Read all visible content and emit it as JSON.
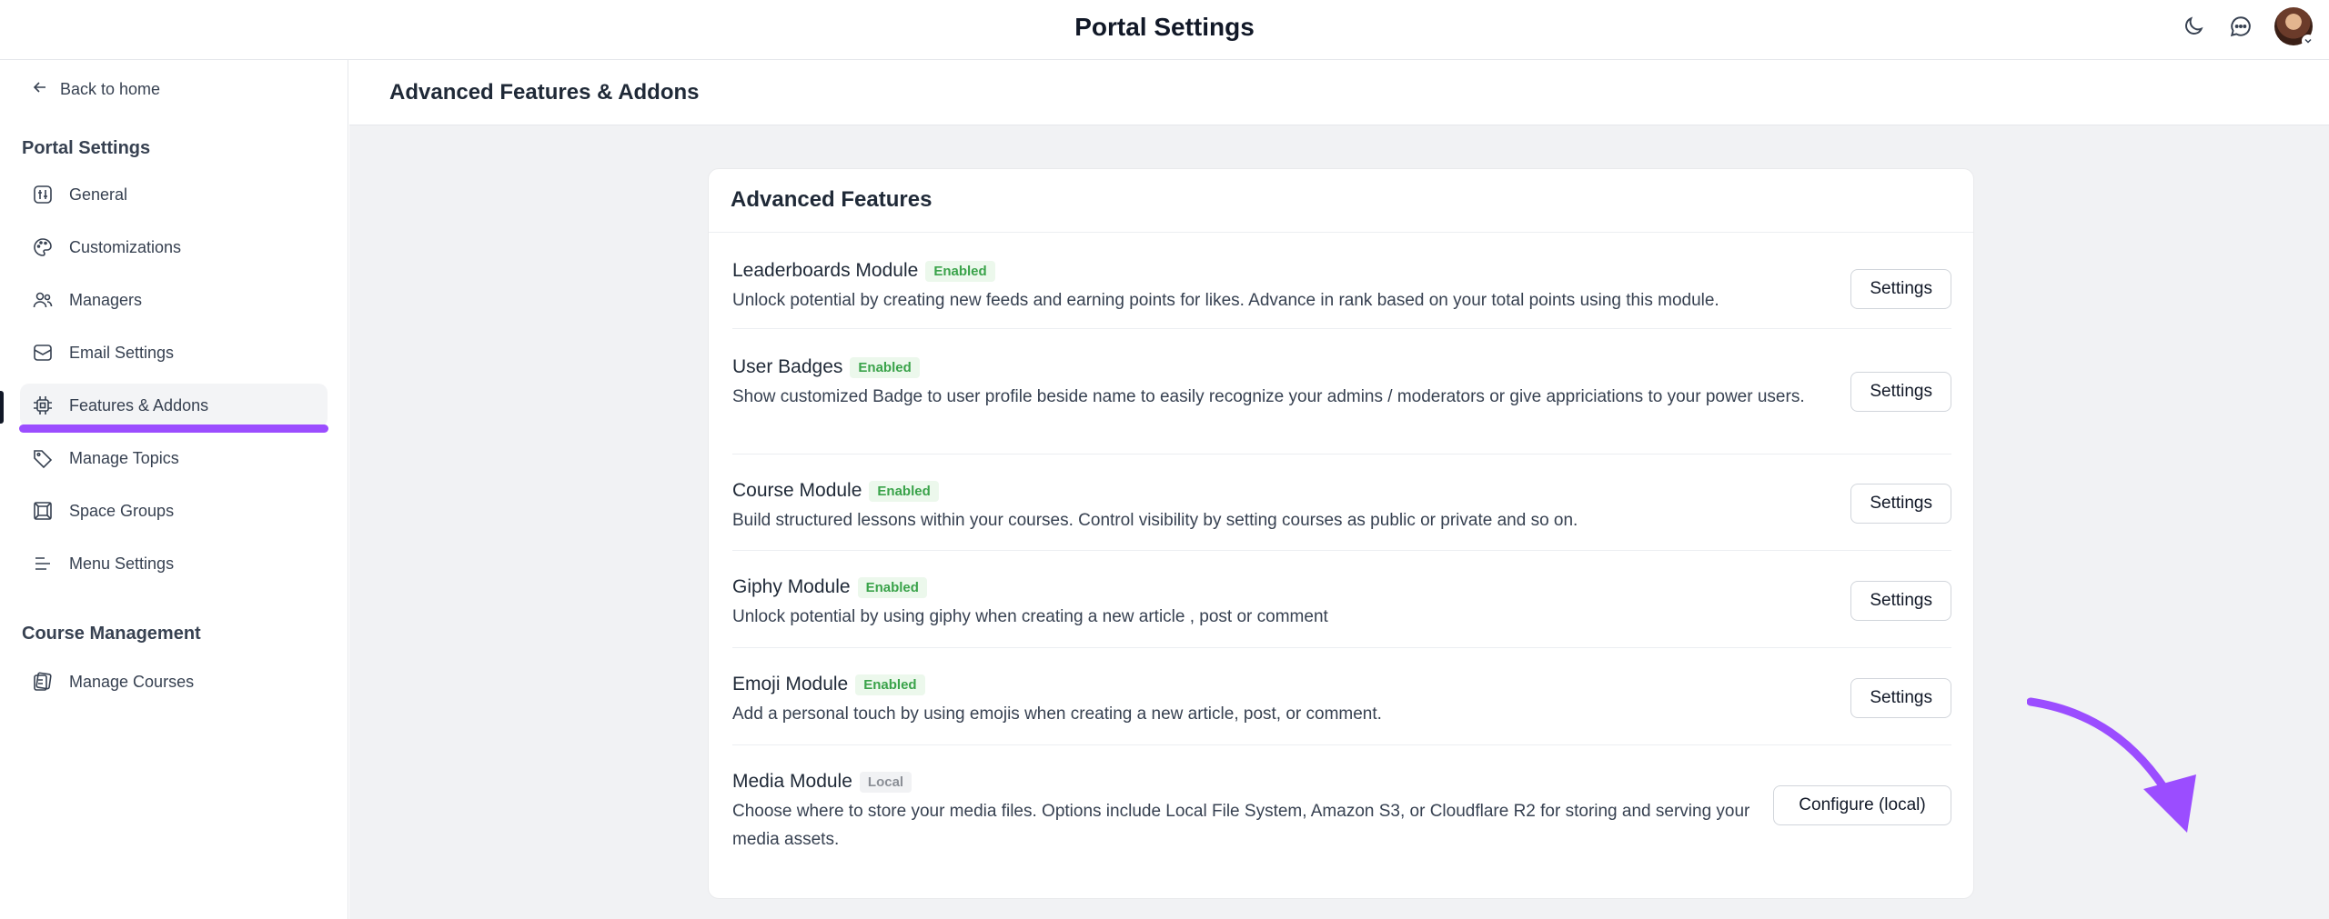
{
  "header": {
    "title": "Portal Settings",
    "icons": [
      "moon-icon",
      "chat-icon",
      "avatar"
    ]
  },
  "sidebar": {
    "back_label": "Back to home",
    "section1_title": "Portal Settings",
    "items": [
      {
        "label": "General",
        "icon": "general-icon"
      },
      {
        "label": "Customizations",
        "icon": "palette-icon"
      },
      {
        "label": "Managers",
        "icon": "users-icon"
      },
      {
        "label": "Email Settings",
        "icon": "mail-icon"
      },
      {
        "label": "Features & Addons",
        "icon": "chip-icon",
        "active": true
      },
      {
        "label": "Manage Topics",
        "icon": "tag-icon"
      },
      {
        "label": "Space Groups",
        "icon": "group-icon"
      },
      {
        "label": "Menu Settings",
        "icon": "menu-icon"
      }
    ],
    "section2_title": "Course Management",
    "items2": [
      {
        "label": "Manage Courses",
        "icon": "courses-icon"
      }
    ]
  },
  "main": {
    "page_title": "Advanced Features & Addons",
    "card_title": "Advanced Features",
    "modules": [
      {
        "name": "Leaderboards Module",
        "badge": "Enabled",
        "desc": "Unlock potential by creating new feeds and earning points for likes. Advance in rank based on your total points using this module.",
        "button": "Settings"
      },
      {
        "name": "User Badges",
        "badge": "Enabled",
        "desc": "Show customized Badge to user profile beside name to easily recognize your admins / moderators or give appriciations to your power users.",
        "button": "Settings"
      },
      {
        "name": "Course Module",
        "badge": "Enabled",
        "desc": "Build structured lessons within your courses. Control visibility by setting courses as public or private and so on.",
        "button": "Settings"
      },
      {
        "name": "Giphy Module",
        "badge": "Enabled",
        "desc": "Unlock potential by using giphy when creating a new article , post or comment",
        "button": "Settings"
      },
      {
        "name": "Emoji Module",
        "badge": "Enabled",
        "desc": "Add a personal touch by using emojis when creating a new article, post, or comment.",
        "button": "Settings"
      },
      {
        "name": "Media Module",
        "badge": "Local",
        "desc": "Choose where to store your media files. Options include Local File System, Amazon S3, or Cloudflare R2 for storing and serving your media assets.",
        "button": "Configure (local)"
      }
    ]
  },
  "colors": {
    "accent": "#9b4dff",
    "enabled_text": "#3aa34a",
    "enabled_bg": "#ecf8ec"
  }
}
